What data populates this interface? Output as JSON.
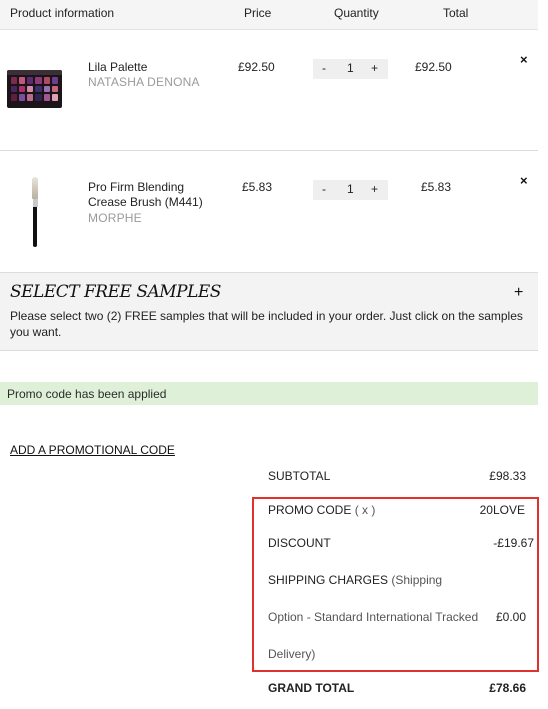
{
  "table_header": {
    "product": "Product information",
    "price": "Price",
    "quantity": "Quantity",
    "total": "Total"
  },
  "items": [
    {
      "name": "Lila Palette",
      "brand": "NATASHA DENONA",
      "price": "£92.50",
      "quantity": "1",
      "total": "£92.50",
      "minus": "-",
      "plus": "+",
      "remove": "×",
      "image_icon": "eyeshadow-palette"
    },
    {
      "name": "Pro Firm Blending Crease Brush (M441)",
      "brand": "MORPHE",
      "price": "£5.83",
      "quantity": "1",
      "total": "£5.83",
      "minus": "-",
      "plus": "+",
      "remove": "×",
      "image_icon": "makeup-brush"
    }
  ],
  "samples": {
    "title": "SELECT FREE SAMPLES",
    "toggle": "+",
    "description": "Please select two (2) FREE samples that will be included in your order. Just click on the samples you want."
  },
  "promo_message": "Promo code has been applied",
  "add_promo_link": "ADD A PROMOTIONAL CODE",
  "summary": {
    "subtotal_label": "SUBTOTAL",
    "subtotal_value": "£98.33",
    "promo_label": "PROMO CODE",
    "promo_remove": "( x )",
    "promo_value": "20LOVE",
    "discount_label": "DISCOUNT",
    "discount_value": "-£19.67",
    "shipping_label": "SHIPPING CHARGES",
    "shipping_detail_1": "(Shipping",
    "shipping_detail_2": "Option - Standard International Tracked",
    "shipping_detail_3": "Delivery)",
    "shipping_value": "£0.00",
    "grand_total_label": "GRAND TOTAL",
    "grand_total_value": "£78.66"
  },
  "colors": {
    "header_bg": "#f5f5f5",
    "success_bg": "#dff0d8",
    "highlight_border": "#e0312f",
    "brand_text": "#9a9a9a"
  }
}
